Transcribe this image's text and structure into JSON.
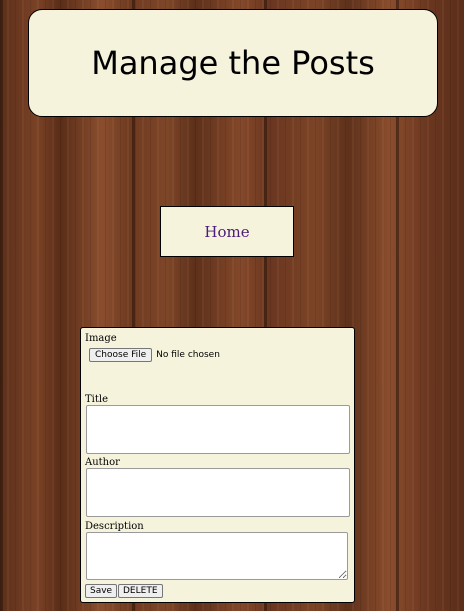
{
  "header": {
    "title": "Manage the Posts"
  },
  "nav": {
    "home_label": "Home"
  },
  "form": {
    "image_label": "Image",
    "choose_file_label": "Choose File",
    "file_status": "No file chosen",
    "title_label": "Title",
    "title_value": "",
    "author_label": "Author",
    "author_value": "",
    "description_label": "Description",
    "description_value": "",
    "save_label": "Save",
    "delete_label": "DELETE"
  },
  "colors": {
    "panel_background": "#f5f3dc",
    "link_color": "#4b1c7a",
    "wood_background": "#6b3a22"
  }
}
